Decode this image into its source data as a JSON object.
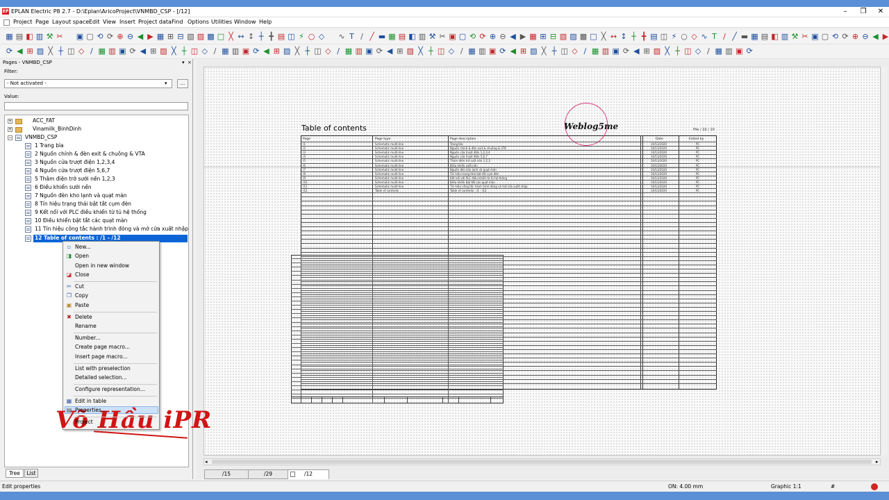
{
  "app": {
    "title": "EPLAN Electric P8 2.7 - D:\\Eplan\\AricoProject\\VNMBD_CSP - [/12]",
    "icon_label": "EP",
    "window_controls": [
      "–",
      "❐",
      "✕"
    ],
    "colors": {
      "accent": "#0a64d6",
      "brand": "#d81e1e",
      "taskbar": "#5b8fd6",
      "watermark": "#d11414"
    }
  },
  "menu": [
    "Project",
    "Page",
    "Layout space",
    "Edit",
    "View",
    "Insert",
    "Project data",
    "Find",
    "Options",
    "Utilities",
    "Window",
    "Help"
  ],
  "panel": {
    "title": "Pages - VNMBD_CSP",
    "pin_icon": "pin-icon",
    "close_icon": "close-icon",
    "filter_label": "Filter:",
    "filter_value": "- Not activated -",
    "filter_button": "...",
    "value_label": "Value:",
    "value_text": "",
    "tabs": [
      "Tree",
      "List"
    ]
  },
  "tree": {
    "projects": [
      {
        "name": "ACC_FAT",
        "expanded": false
      },
      {
        "name": "Vinamilk_BinhDinh",
        "expanded": false
      },
      {
        "name": "VNMBD_CSP",
        "expanded": true
      }
    ],
    "pages": [
      "1 Trang bìa",
      "2 Nguồn chính & đèn exit & chuông & VTA",
      "3 Nguồn cửa trượt điện 1,2,3,4",
      "4 Nguồn cửa trượt điện 5,6,7",
      "5 Thâm điện trở sưởi nền 1,2,3",
      "6 Điều khiển sưởi nền",
      "7 Nguồn đèn kho lạnh và quạt màn",
      "8 Tín hiệu trạng thái bật tắt cụm đèn",
      "9 Kết nối với PLC điều khiển từ tủ hệ thống",
      "10 Điều khiển bật tắt các quạt màn",
      "11 Tín hiệu công tắc hành trình đóng và mở cửa xuất nhập",
      "12 Table of contents : /1 - /12"
    ],
    "selected_index": 11
  },
  "context_menu": {
    "items": [
      {
        "label": "New...",
        "icon": "new-page-icon"
      },
      {
        "label": "Open",
        "icon": "open-icon"
      },
      {
        "label": "Open in new window",
        "icon": ""
      },
      {
        "label": "Close",
        "icon": "close-page-icon"
      },
      {
        "label": "Cut",
        "icon": "cut-icon"
      },
      {
        "label": "Copy",
        "icon": "copy-icon"
      },
      {
        "label": "Paste",
        "icon": "paste-icon"
      },
      {
        "label": "Delete",
        "icon": "delete-icon"
      },
      {
        "label": "Rename",
        "icon": ""
      },
      {
        "label": "Number...",
        "icon": ""
      },
      {
        "label": "Create page macro...",
        "icon": ""
      },
      {
        "label": "Insert page macro...",
        "icon": ""
      },
      {
        "label": "List with preselection",
        "icon": ""
      },
      {
        "label": "Detailed selection...",
        "icon": ""
      },
      {
        "label": "Configure representation...",
        "icon": ""
      },
      {
        "label": "Edit in table",
        "icon": "table-icon"
      },
      {
        "label": "Properties...",
        "icon": "properties-icon"
      },
      {
        "label": "Project",
        "icon": ""
      }
    ],
    "hovered": "Properties..."
  },
  "watermark": {
    "text": "Võ Hầu iPR"
  },
  "sheet": {
    "title": "Table of contents",
    "page_ref": "File / 10 / 10",
    "logo_text": "Weblog5me",
    "columns": [
      "Page",
      "Page type",
      "Page description",
      "Date",
      "Edited by"
    ],
    "rows": [
      [
        "/1",
        "Schematic multi-line",
        "Trang bìa",
        "10/13/2020",
        "PC"
      ],
      [
        "/2",
        "Schematic multi-line",
        "Nguồn chính & đèn exit & chuông & VTA",
        "10/13/2020",
        "PC"
      ],
      [
        "/3",
        "Schematic multi-line",
        "Nguồn cửa trượt điện 1,2,3,4",
        "10/13/2020",
        "PC"
      ],
      [
        "/4",
        "Schematic multi-line",
        "Nguồn cửa trượt điện 5,6,7",
        "10/13/2020",
        "PC"
      ],
      [
        "/5",
        "Schematic multi-line",
        "Thâm điện trở sưởi nền 1,2,3",
        "10/13/2020",
        "PC"
      ],
      [
        "/6",
        "Schematic multi-line",
        "Điều khiển sưởi nền",
        "10/13/2020",
        "PC"
      ],
      [
        "/7",
        "Schematic multi-line",
        "Nguồn đèn kho lạnh và quạt màn",
        "10/13/2020",
        "PC"
      ],
      [
        "/8",
        "Schematic multi-line",
        "Tín hiệu trạng thái bật tắt cụm đèn",
        "10/13/2020",
        "PC"
      ],
      [
        "/9",
        "Schematic multi-line",
        "Kết nối với PLC điều khiển từ tủ hệ thống",
        "10/13/2020",
        "PC"
      ],
      [
        "/10",
        "Schematic multi-line",
        "Điều khiển bật tắt các quạt màn",
        "10/13/2020",
        "PC"
      ],
      [
        "/11",
        "Schematic multi-line",
        "Tín hiệu công tắc hành trình đóng và mở cửa xuất nhập",
        "10/13/2020",
        "PC"
      ],
      [
        "/12",
        "Table of contents",
        "Table of contents : /1 - /12",
        "10/13/2020",
        "PC"
      ]
    ]
  },
  "page_tabs": [
    {
      "label": "/15",
      "active": false
    },
    {
      "label": "/29",
      "active": false
    },
    {
      "label": "/12",
      "active": true
    }
  ],
  "status": {
    "left": "Edit properties",
    "on": "ON: 4.00 mm",
    "graphic": "Graphic 1:1",
    "hash": "#"
  }
}
